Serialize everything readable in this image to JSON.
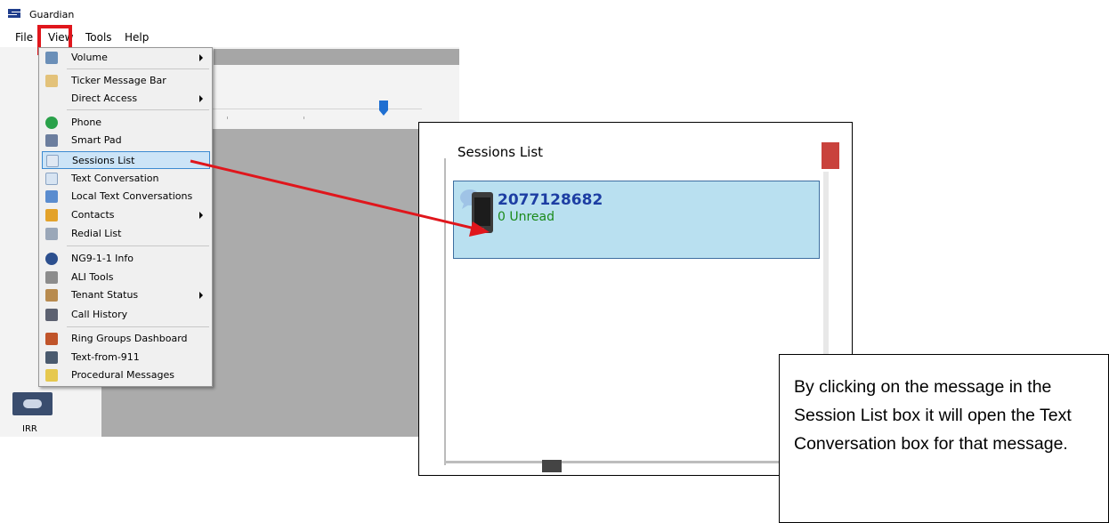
{
  "window": {
    "title": "Guardian",
    "logo_icon": "guardian-logo-icon"
  },
  "menubar": {
    "items": [
      "File",
      "View",
      "Tools",
      "Help"
    ]
  },
  "view_menu": {
    "items": [
      {
        "label": "Volume",
        "icon": "volume-icon",
        "submenu": true
      },
      {
        "label": "Ticker Message Bar",
        "icon": "ticker-icon",
        "submenu": false
      },
      {
        "label": "Direct Access",
        "icon": "",
        "submenu": true
      },
      {
        "label": "Phone",
        "icon": "phone-icon",
        "submenu": false
      },
      {
        "label": "Smart Pad",
        "icon": "smart-pad-icon",
        "submenu": false
      },
      {
        "label": "Sessions List",
        "icon": "sessions-list-icon",
        "submenu": false,
        "selected": true
      },
      {
        "label": "Text Conversation",
        "icon": "text-conversation-icon",
        "submenu": false
      },
      {
        "label": "Local Text Conversations",
        "icon": "folder-icon",
        "submenu": false
      },
      {
        "label": "Contacts",
        "icon": "contacts-icon",
        "submenu": true
      },
      {
        "label": "Redial List",
        "icon": "redial-icon",
        "submenu": false
      },
      {
        "label": "NG9-1-1 Info",
        "icon": "info-icon",
        "submenu": false
      },
      {
        "label": "ALI Tools",
        "icon": "tools-icon",
        "submenu": false
      },
      {
        "label": "Tenant Status",
        "icon": "tenant-icon",
        "submenu": true
      },
      {
        "label": "Call History",
        "icon": "call-history-icon",
        "submenu": false
      },
      {
        "label": "Ring Groups Dashboard",
        "icon": "ring-groups-icon",
        "submenu": false
      },
      {
        "label": "Text-from-911",
        "icon": "text-911-icon",
        "submenu": false
      },
      {
        "label": "Procedural Messages",
        "icon": "procedural-icon",
        "submenu": false
      }
    ]
  },
  "left_panel": {
    "irr_label": "IRR"
  },
  "sessions_panel": {
    "title": "Sessions List",
    "session": {
      "number": "2077128682",
      "unread": "0 Unread"
    }
  },
  "annotation": {
    "text": "By clicking on the message in the Session List box it will open the Text Conversation box for that message."
  },
  "colors": {
    "highlight_red": "#e0161c",
    "selected_bg": "#cce4f7",
    "card_bg": "#b9e0f0",
    "number_blue": "#1d3ea3",
    "unread_green": "#1a8a1a"
  }
}
